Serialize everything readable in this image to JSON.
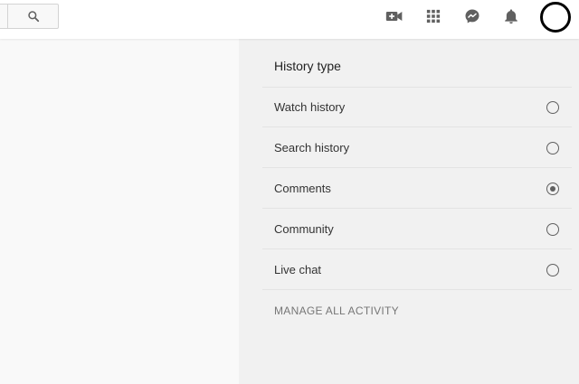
{
  "header": {
    "icons": [
      "search-icon",
      "upload-video-icon",
      "apps-grid-icon",
      "messages-icon",
      "notifications-bell-icon",
      "avatar"
    ]
  },
  "panel": {
    "title": "History type",
    "options": [
      {
        "label": "Watch history",
        "selected": false
      },
      {
        "label": "Search history",
        "selected": false
      },
      {
        "label": "Comments",
        "selected": true
      },
      {
        "label": "Community",
        "selected": false
      },
      {
        "label": "Live chat",
        "selected": false
      }
    ],
    "manage_label": "MANAGE ALL ACTIVITY"
  }
}
